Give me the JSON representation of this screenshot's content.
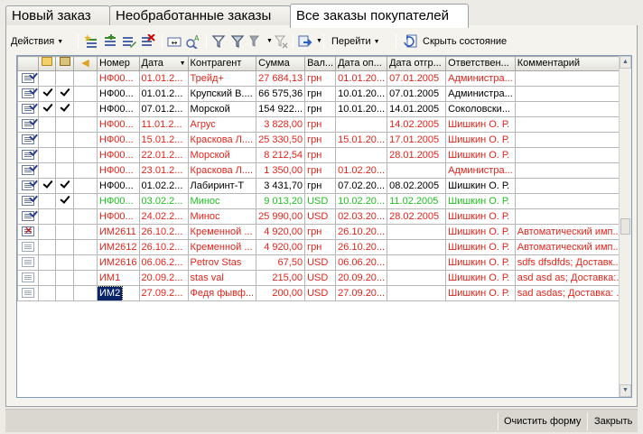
{
  "tabs": [
    "Новый заказ",
    "Необработанные заказы",
    "Все заказы покупателей"
  ],
  "toolbar": {
    "actions_label": "Действия",
    "goto_label": "Перейти",
    "hide_state_label": "Скрыть состояние",
    "icons": [
      "add-icon",
      "add-copy-icon",
      "edit-icon",
      "delete-mark-icon",
      "interval-icon",
      "find-icon",
      "filter-icon",
      "filter-selection-icon",
      "filter-history-icon",
      "cancel-filter-icon",
      "create-based-on-icon",
      "refresh-icon"
    ]
  },
  "grid": {
    "columns": [
      "",
      "",
      "",
      "Номер",
      "Дата",
      "Контрагент",
      "Сумма",
      "Вал...",
      "Дата оп...",
      "Дата отгр...",
      "Ответствен...",
      "Комментарий"
    ],
    "sort_column": "Дата",
    "rows": [
      {
        "style": "red",
        "icon": "posted",
        "c1": false,
        "c2": false,
        "cells": [
          "НФ00...",
          "01.01.2...",
          "Трейд+",
          "27 684,13",
          "грн",
          "01.01.20...",
          "07.01.2005",
          "Администра...",
          ""
        ]
      },
      {
        "style": "black",
        "icon": "posted",
        "c1": true,
        "c2": true,
        "cells": [
          "НФ00...",
          "01.01.2...",
          "Крупский В....",
          "66 575,36",
          "грн",
          "10.01.20...",
          "07.01.2005",
          "Администра...",
          ""
        ]
      },
      {
        "style": "black",
        "icon": "posted",
        "c1": true,
        "c2": true,
        "cells": [
          "НФ00...",
          "07.01.2...",
          "Морской",
          "154 922...",
          "грн",
          "10.01.20...",
          "14.01.2005",
          "Соколовски...",
          ""
        ]
      },
      {
        "style": "red",
        "icon": "posted",
        "c1": false,
        "c2": false,
        "cells": [
          "НФ00...",
          "11.01.2...",
          "Агрус",
          "3 828,00",
          "грн",
          "",
          "14.02.2005",
          "Шишкин О. Р.",
          ""
        ]
      },
      {
        "style": "red",
        "icon": "posted",
        "c1": false,
        "c2": false,
        "cells": [
          "НФ00...",
          "15.01.2...",
          "Краскова Л....",
          "25 330,50",
          "грн",
          "15.01.20...",
          "17.01.2005",
          "Шишкин О. Р.",
          ""
        ]
      },
      {
        "style": "red",
        "icon": "posted",
        "c1": false,
        "c2": false,
        "cells": [
          "НФ00...",
          "22.01.2...",
          "Морской",
          "8 212,54",
          "грн",
          "",
          "28.01.2005",
          "Шишкин О. Р.",
          ""
        ]
      },
      {
        "style": "red",
        "icon": "posted",
        "c1": false,
        "c2": false,
        "cells": [
          "НФ00...",
          "23.01.2...",
          "Краскова Л....",
          "1 350,00",
          "грн",
          "01.02.20...",
          "",
          "Администра...",
          ""
        ]
      },
      {
        "style": "black",
        "icon": "posted",
        "c1": true,
        "c2": true,
        "cells": [
          "НФ00...",
          "01.02.2...",
          "Лабиринт-Т",
          "3 431,70",
          "грн",
          "07.02.20...",
          "08.02.2005",
          "Шишкин О. Р.",
          ""
        ]
      },
      {
        "style": "green",
        "icon": "posted",
        "c1": false,
        "c2": true,
        "cells": [
          "НФ00...",
          "03.02.2...",
          "Минос",
          "9 013,20",
          "USD",
          "10.02.20...",
          "11.02.2005",
          "Шишкин О. Р.",
          ""
        ]
      },
      {
        "style": "red",
        "icon": "posted",
        "c1": false,
        "c2": false,
        "cells": [
          "НФ00...",
          "24.02.2...",
          "Минос",
          "25 990,00",
          "USD",
          "02.03.20...",
          "28.02.2005",
          "Шишкин О. Р.",
          ""
        ]
      },
      {
        "style": "red",
        "icon": "deleted",
        "c1": false,
        "c2": false,
        "cells": [
          "ИМ2611",
          "26.10.2...",
          "Кременной ...",
          "4 920,00",
          "грн",
          "26.10.20...",
          "",
          "Шишкин О. Р.",
          "Автоматический имп..."
        ]
      },
      {
        "style": "red",
        "icon": "plain",
        "c1": false,
        "c2": false,
        "cells": [
          "ИМ2612",
          "26.10.2...",
          "Кременной ...",
          "4 920,00",
          "грн",
          "26.10.20...",
          "",
          "Шишкин О. Р.",
          "Автоматический имп..."
        ]
      },
      {
        "style": "red",
        "icon": "plain",
        "c1": false,
        "c2": false,
        "cells": [
          "ИМ2616",
          "06.06.2...",
          "Petrov Stas",
          "67,50",
          "USD",
          "06.06.20...",
          "",
          "Шишкин О. Р.",
          "sdfs dfsdfds; Доставк..."
        ]
      },
      {
        "style": "red",
        "icon": "plain",
        "c1": false,
        "c2": false,
        "cells": [
          "ИМ1",
          "20.09.2...",
          "stas val",
          "215,00",
          "USD",
          "20.09.20...",
          "",
          "Шишкин О. Р.",
          "asd asd as; Доставка:..."
        ]
      },
      {
        "style": "red",
        "icon": "plain",
        "c1": false,
        "c2": false,
        "selected": true,
        "cells": [
          "ИМ2",
          "27.09.2...",
          "Федя фывф...",
          "200,00",
          "USD",
          "27.09.20...",
          "",
          "Шишкин О. Р.",
          "sad asdas; Доставка: ..."
        ]
      }
    ]
  },
  "bottom": {
    "clear_form_label": "Очистить форму",
    "close_label": "Закрыть"
  },
  "colors": {
    "red_text": "#e3241b",
    "green_text": "#20c020",
    "selection": "#0a246a"
  }
}
